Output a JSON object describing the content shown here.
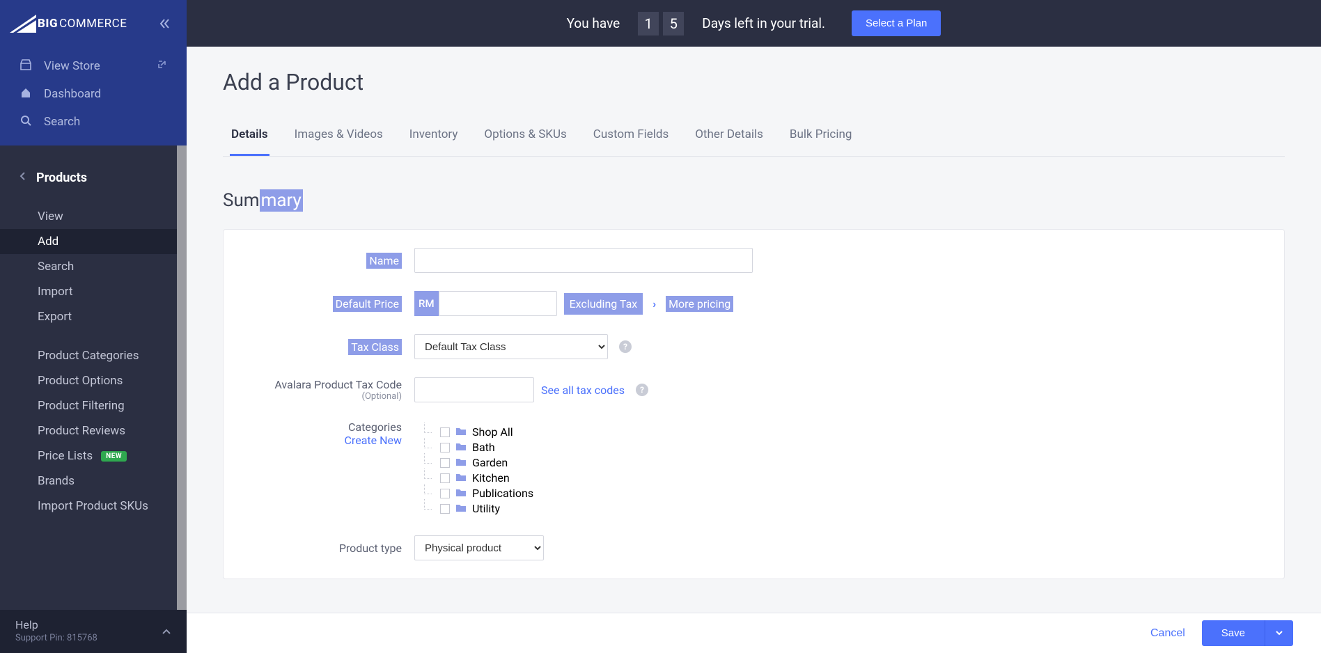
{
  "brand": {
    "big": "BIG",
    "commerce": "COMMERCE"
  },
  "topLinks": {
    "viewStore": "View Store",
    "dashboard": "Dashboard",
    "search": "Search"
  },
  "sidebar": {
    "section": "Products",
    "items": [
      {
        "label": "View"
      },
      {
        "label": "Add",
        "active": true
      },
      {
        "label": "Search"
      },
      {
        "label": "Import"
      },
      {
        "label": "Export"
      }
    ],
    "items2": [
      {
        "label": "Product Categories"
      },
      {
        "label": "Product Options"
      },
      {
        "label": "Product Filtering"
      },
      {
        "label": "Product Reviews"
      },
      {
        "label": "Price Lists",
        "new": true
      },
      {
        "label": "Brands"
      },
      {
        "label": "Import Product SKUs"
      }
    ],
    "footer": {
      "help": "Help",
      "pin": "Support Pin: 815768"
    }
  },
  "trial": {
    "prefix": "You have",
    "d1": "1",
    "d2": "5",
    "suffix": "Days left in your trial.",
    "cta": "Select a Plan"
  },
  "page": {
    "title": "Add a Product",
    "tabs": [
      "Details",
      "Images & Videos",
      "Inventory",
      "Options & SKUs",
      "Custom Fields",
      "Other Details",
      "Bulk Pricing"
    ],
    "activeTab": 0,
    "sectionTitle": {
      "plain": "Sum",
      "hl": "mary"
    }
  },
  "form": {
    "name": {
      "label": "Name",
      "value": ""
    },
    "price": {
      "label": "Default Price",
      "currency": "RM",
      "value": "",
      "taxNote": "Excluding Tax",
      "more": "More pricing"
    },
    "taxClass": {
      "label": "Tax Class",
      "value": "Default Tax Class"
    },
    "avalara": {
      "label": "Avalara Product Tax Code",
      "optional": "(Optional)",
      "value": "",
      "link": "See all tax codes"
    },
    "categories": {
      "label": "Categories",
      "createLink": "Create New",
      "items": [
        "Shop All",
        "Bath",
        "Garden",
        "Kitchen",
        "Publications",
        "Utility"
      ]
    },
    "productType": {
      "label": "Product type",
      "value": "Physical product"
    }
  },
  "footer": {
    "cancel": "Cancel",
    "save": "Save"
  },
  "badges": {
    "new": "NEW"
  }
}
